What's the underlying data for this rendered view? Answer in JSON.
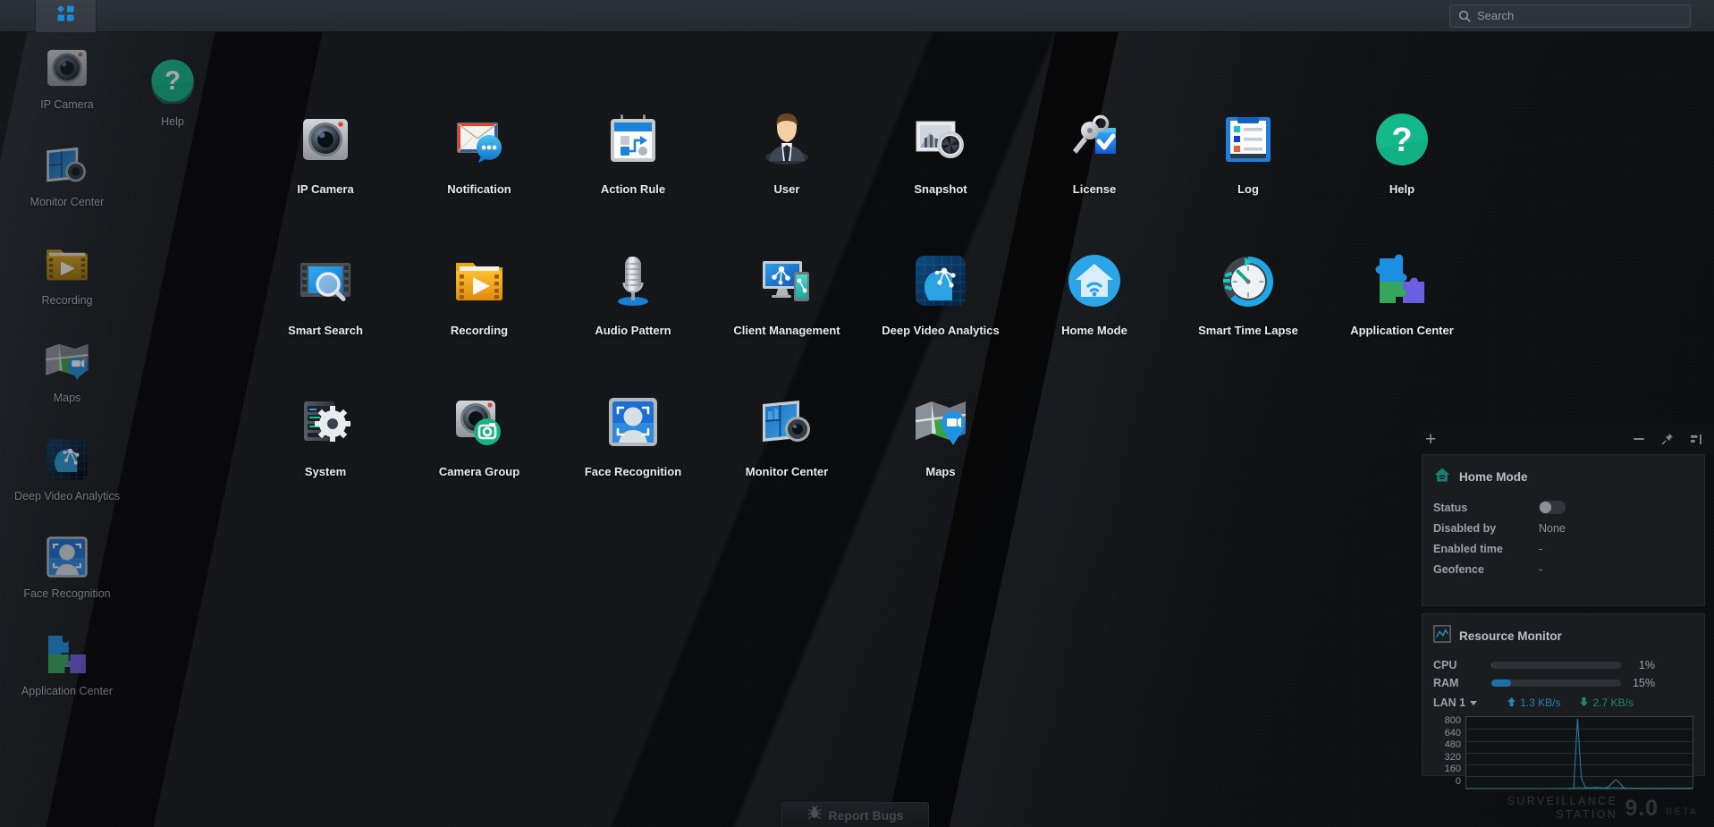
{
  "app": {
    "name": "Surveillance Station",
    "brand_line1": "SURVEILLANCE",
    "brand_line2": "STATION",
    "version": "9.0",
    "release_tag": "BETA"
  },
  "topbar": {
    "main_menu_icon": "grid-apps-icon",
    "search": {
      "icon": "search-icon",
      "placeholder": "Search",
      "value": ""
    }
  },
  "desktop_shortcuts": [
    {
      "label": "IP Camera",
      "icon": "ip-camera-icon"
    },
    {
      "label": "Monitor Center",
      "icon": "monitor-center-icon"
    },
    {
      "label": "Recording",
      "icon": "recording-folder-icon"
    },
    {
      "label": "Maps",
      "icon": "maps-icon"
    },
    {
      "label": "Deep Video Analytics",
      "icon": "deep-video-analytics-icon"
    },
    {
      "label": "Face Recognition",
      "icon": "face-recognition-icon"
    },
    {
      "label": "Application Center",
      "icon": "application-center-icon"
    }
  ],
  "help_shortcut": {
    "label": "Help",
    "icon": "help-icon"
  },
  "app_grid": [
    {
      "label": "IP Camera",
      "icon": "ip-camera-icon"
    },
    {
      "label": "Notification",
      "icon": "notification-icon"
    },
    {
      "label": "Action Rule",
      "icon": "action-rule-icon"
    },
    {
      "label": "User",
      "icon": "user-icon"
    },
    {
      "label": "Snapshot",
      "icon": "snapshot-icon"
    },
    {
      "label": "License",
      "icon": "license-key-icon"
    },
    {
      "label": "Log",
      "icon": "log-clipboard-icon"
    },
    {
      "label": "Help",
      "icon": "help-icon"
    },
    {
      "label": "Smart Search",
      "icon": "smart-search-icon"
    },
    {
      "label": "Recording",
      "icon": "recording-folder-icon"
    },
    {
      "label": "Audio Pattern",
      "icon": "audio-pattern-microphone-icon"
    },
    {
      "label": "Client Management",
      "icon": "client-management-icon"
    },
    {
      "label": "Deep Video Analytics",
      "icon": "deep-video-analytics-icon"
    },
    {
      "label": "Home Mode",
      "icon": "home-mode-icon"
    },
    {
      "label": "Smart Time Lapse",
      "icon": "smart-time-lapse-icon"
    },
    {
      "label": "Application Center",
      "icon": "application-center-icon"
    },
    {
      "label": "System",
      "icon": "system-gear-icon"
    },
    {
      "label": "Camera Group",
      "icon": "camera-group-icon"
    },
    {
      "label": "Face Recognition",
      "icon": "face-recognition-icon"
    },
    {
      "label": "Monitor Center",
      "icon": "monitor-center-icon"
    },
    {
      "label": "Maps",
      "icon": "maps-icon"
    }
  ],
  "widget_panel": {
    "add_label": "+",
    "controls": [
      {
        "name": "minimize",
        "icon": "minimize-icon"
      },
      {
        "name": "pin",
        "icon": "pin-icon"
      },
      {
        "name": "collapse",
        "icon": "collapse-panel-icon"
      }
    ],
    "home_mode": {
      "title": "Home Mode",
      "icon": "home-mode-icon",
      "rows": [
        {
          "key": "Status",
          "value": "",
          "type": "toggle",
          "on": false
        },
        {
          "key": "Disabled by",
          "value": "None",
          "type": "text"
        },
        {
          "key": "Enabled time",
          "value": "-",
          "type": "text"
        },
        {
          "key": "Geofence",
          "value": "-",
          "type": "text"
        }
      ]
    },
    "resource_monitor": {
      "title": "Resource Monitor",
      "icon": "resource-monitor-icon",
      "cpu_label": "CPU",
      "cpu_percent": "1%",
      "cpu_value": 1,
      "ram_label": "RAM",
      "ram_percent": "15%",
      "ram_value": 15,
      "lan_label": "LAN 1",
      "upload": "1.3 KB/s",
      "download": "2.7 KB/s",
      "upload_color": "#2c7fb0",
      "download_color": "#1f8a6d",
      "chart_data": {
        "type": "line",
        "title": "LAN 1 traffic",
        "xlabel": "",
        "ylabel": "",
        "ylim": [
          0,
          800
        ],
        "yticks": [
          800,
          640,
          480,
          320,
          160,
          0
        ],
        "grid": true,
        "legend": [
          "1.3 KB/s",
          "2.7 KB/s"
        ],
        "series": [
          {
            "name": "upload",
            "color": "#2c7fb0",
            "values": [
              0,
              0,
              0,
              0,
              0,
              0,
              0,
              0,
              0,
              0,
              0,
              0,
              0,
              0,
              0,
              0,
              0,
              0,
              0,
              0,
              0,
              0,
              0,
              0,
              0,
              0,
              0,
              2,
              4,
              780,
              120,
              18,
              8,
              10,
              14,
              10,
              6,
              18,
              60,
              100,
              62,
              10,
              4,
              3,
              3,
              4,
              3,
              3,
              4,
              3,
              3,
              4,
              3,
              4,
              3,
              4,
              3,
              3,
              4,
              3
            ]
          },
          {
            "name": "download",
            "color": "#1f8a6d",
            "values": [
              0,
              0,
              0,
              0,
              0,
              0,
              0,
              0,
              0,
              0,
              0,
              0,
              0,
              0,
              0,
              0,
              0,
              0,
              0,
              0,
              0,
              0,
              0,
              0,
              0,
              0,
              0,
              1,
              2,
              10,
              8,
              5,
              4,
              6,
              8,
              7,
              5,
              6,
              9,
              10,
              8,
              4,
              2,
              2,
              2,
              2,
              2,
              2,
              2,
              2,
              2,
              2,
              2,
              2,
              2,
              2,
              2,
              2,
              2,
              2
            ]
          }
        ]
      }
    }
  },
  "footer": {
    "report_bugs_label": "Report Bugs",
    "report_bugs_icon": "bug-icon"
  },
  "colors": {
    "accent_blue": "#1e8bd8",
    "green": "#14b88a",
    "topbar_bg": "#2b3138",
    "desktop_bg": "#0d0e10",
    "panel_bg": "#1a1d20"
  }
}
